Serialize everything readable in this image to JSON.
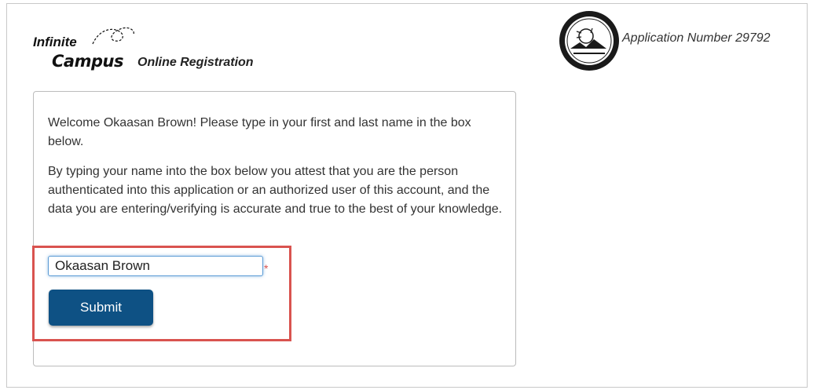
{
  "header": {
    "logo_line1": "Infinite",
    "logo_line2": "Campus",
    "logo_subtitle": "Online Registration",
    "seal_icon": "state-of-hawaii-department-of-education-seal",
    "application_number": "Application Number 29792"
  },
  "form": {
    "welcome_text": "Welcome Okaasan Brown! Please type in your first and last name in the box below.",
    "attest_text": "By typing your name into the box below you attest that you are the person authenticated into this application or an authorized user of this account, and the data you are entering/verifying is accurate and true to the best of your knowledge.",
    "name_value": "Okaasan Brown",
    "required_marker": "*",
    "submit_label": "Submit"
  },
  "colors": {
    "submit_bg": "#0e5184",
    "highlight_border": "#d9534f",
    "input_focus": "#5b9bd5"
  }
}
